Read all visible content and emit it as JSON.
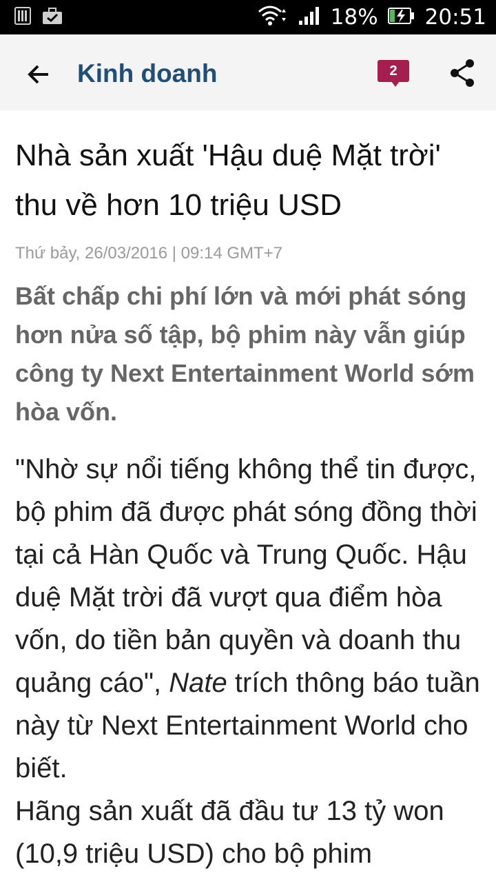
{
  "status_bar": {
    "battery": "18%",
    "time": "20:51",
    "icons": [
      "sim-icon",
      "briefcase-icon",
      "wifi-icon",
      "signal-icon",
      "battery-charging-icon"
    ]
  },
  "app_bar": {
    "title": "Kinh doanh",
    "comment_count": "2",
    "accent_color": "#a61e4d",
    "title_color": "#1f4e79"
  },
  "article": {
    "headline": "Nhà sản xuất 'Hậu duệ Mặt trời' thu về hơn 10 triệu USD",
    "date": "Thứ bảy, 26/03/2016 | 09:14 GMT+7",
    "lead": "Bất chấp chi phí lớn và mới phát sóng hơn nửa số tập, bộ phim này vẫn giúp công ty Next Entertainment World sớm hòa vốn.",
    "para1_a": "\"Nhờ sự nổi tiếng không thể tin được, bộ phim đã được phát sóng đồng thời tại cả Hàn Quốc và Trung Quốc. Hậu duệ Mặt trời đã vượt qua điểm hòa vốn, do tiền bản quyền và doanh thu quảng cáo\", ",
    "para1_source": "Nate",
    "para1_b": " trích thông báo tuần này từ Next Entertainment World cho biết.",
    "para2": "Hãng sản xuất đã đầu tư 13 tỷ won (10,9 triệu USD) cho bộ phim"
  }
}
